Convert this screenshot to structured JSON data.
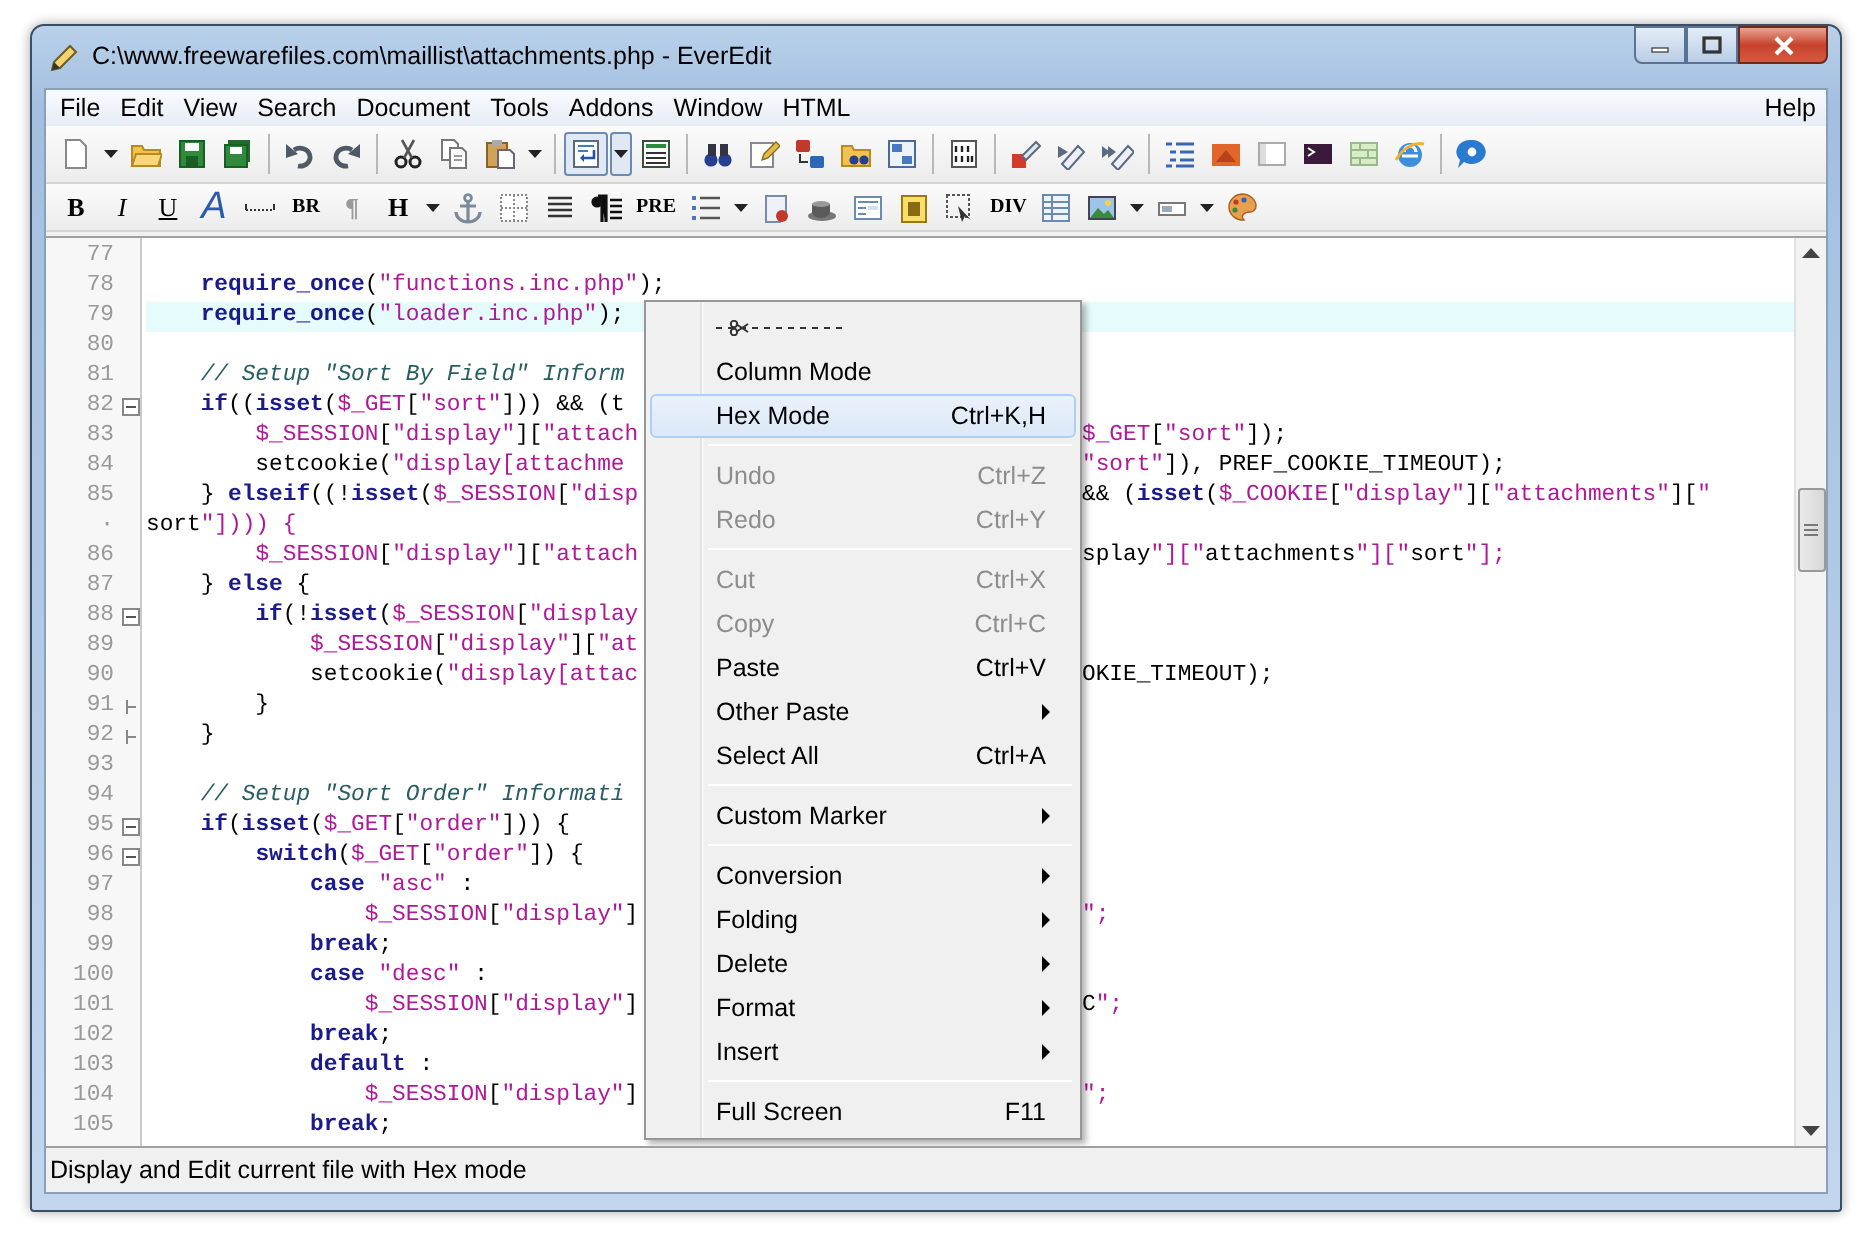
{
  "window": {
    "title": "C:\\www.freewarefiles.com\\maillist\\attachments.php - EverEdit"
  },
  "menus": [
    {
      "label": "File"
    },
    {
      "label": "Edit"
    },
    {
      "label": "View"
    },
    {
      "label": "Search"
    },
    {
      "label": "Document"
    },
    {
      "label": "Tools"
    },
    {
      "label": "Addons"
    },
    {
      "label": "Window"
    },
    {
      "label": "HTML"
    }
  ],
  "menus_right": [
    {
      "label": "Help"
    }
  ],
  "toolbars": [
    [
      {
        "kind": "icon",
        "pressed": false
      },
      {
        "kind": "drop",
        "pressed": false
      },
      {
        "kind": "icon",
        "pressed": false
      },
      {
        "kind": "icon",
        "pressed": false
      },
      {
        "kind": "icon",
        "pressed": false
      },
      {
        "kind": "sep"
      },
      {
        "kind": "icon",
        "pressed": false
      },
      {
        "kind": "icon",
        "pressed": false
      },
      {
        "kind": "sep"
      },
      {
        "kind": "icon",
        "pressed": false
      },
      {
        "kind": "icon",
        "pressed": false
      },
      {
        "kind": "icon",
        "pressed": false
      },
      {
        "kind": "drop",
        "pressed": false
      },
      {
        "kind": "sep"
      },
      {
        "kind": "icon",
        "pressed": true
      },
      {
        "kind": "drop",
        "pressed": true
      },
      {
        "kind": "icon",
        "pressed": false
      },
      {
        "kind": "sep"
      },
      {
        "kind": "icon",
        "pressed": false
      },
      {
        "kind": "icon",
        "pressed": false
      },
      {
        "kind": "icon",
        "pressed": false
      },
      {
        "kind": "icon",
        "pressed": false
      },
      {
        "kind": "icon",
        "pressed": false
      },
      {
        "kind": "sep"
      },
      {
        "kind": "icon",
        "pressed": false
      },
      {
        "kind": "sep"
      },
      {
        "kind": "icon",
        "pressed": false
      },
      {
        "kind": "icon",
        "pressed": false
      },
      {
        "kind": "icon",
        "pressed": false
      },
      {
        "kind": "sep"
      },
      {
        "kind": "icon",
        "pressed": false
      },
      {
        "kind": "icon",
        "pressed": false
      },
      {
        "kind": "icon",
        "pressed": false
      },
      {
        "kind": "icon",
        "pressed": false
      },
      {
        "kind": "icon",
        "pressed": false
      },
      {
        "kind": "icon",
        "pressed": false
      },
      {
        "kind": "sep"
      },
      {
        "kind": "icon",
        "pressed": false
      }
    ],
    [
      {
        "kind": "text",
        "label": "B",
        "disabled": false
      },
      {
        "kind": "text",
        "label": "I",
        "disabled": false
      },
      {
        "kind": "text",
        "label": "U",
        "disabled": false
      },
      {
        "kind": "text",
        "label": "A",
        "disabled": false
      },
      {
        "kind": "icon",
        "pressed": false
      },
      {
        "kind": "text",
        "label": "BR",
        "disabled": false
      },
      {
        "kind": "text",
        "label": "¶",
        "disabled": true
      },
      {
        "kind": "text",
        "label": "H",
        "disabled": false
      },
      {
        "kind": "drop",
        "pressed": false
      },
      {
        "kind": "icon",
        "pressed": false
      },
      {
        "kind": "icon",
        "pressed": false
      },
      {
        "kind": "icon",
        "pressed": false
      },
      {
        "kind": "icon",
        "pressed": false
      },
      {
        "kind": "text",
        "label": "PRE",
        "disabled": false
      },
      {
        "kind": "icon",
        "pressed": false
      },
      {
        "kind": "drop",
        "pressed": false
      },
      {
        "kind": "icon",
        "pressed": false
      },
      {
        "kind": "icon",
        "pressed": false
      },
      {
        "kind": "icon",
        "pressed": false
      },
      {
        "kind": "icon",
        "pressed": false
      },
      {
        "kind": "icon",
        "pressed": false
      },
      {
        "kind": "text",
        "label": "DIV",
        "disabled": false
      },
      {
        "kind": "icon",
        "pressed": false
      },
      {
        "kind": "icon",
        "pressed": false
      },
      {
        "kind": "drop",
        "pressed": false
      },
      {
        "kind": "icon",
        "pressed": false
      },
      {
        "kind": "drop",
        "pressed": false
      },
      {
        "kind": "icon",
        "pressed": false
      }
    ]
  ],
  "editor": {
    "lines": [
      {
        "kind": "plain",
        "num": "77",
        "current": false
      },
      {
        "kind": "plain",
        "num": "78",
        "text": "    require_once(\"functions.inc.php\");",
        "current": false
      },
      {
        "kind": "plain",
        "num": "79",
        "text": "    require_once(\"loader.inc.php\");",
        "current": true
      },
      {
        "kind": "plain",
        "num": "80",
        "current": false
      },
      {
        "kind": "plain",
        "num": "81",
        "text": "    // Setup \"Sort By Field\" Inform",
        "current": false
      },
      {
        "kind": "foldstart",
        "num": "82",
        "text": "    if((isset($_GET[\"sort\"])) && (t",
        "current": false
      },
      {
        "kind": "plain",
        "num": "83",
        "text": "        $_SESSION[\"display\"][\"attach",
        "tail": "$_GET[\"sort\"]);",
        "current": false
      },
      {
        "kind": "plain",
        "num": "84",
        "text": "        setcookie(\"display[attachme",
        "tail": "\"sort\"]), PREF_COOKIE_TIMEOUT);",
        "current": false
      },
      {
        "kind": "plain",
        "num": "85",
        "text": "    } elseif((!isset($_SESSION[\"disp",
        "tail": "&& (isset($_COOKIE[\"display\"][\"attachments\"][\"",
        "current": false
      },
      {
        "kind": "plain",
        "num": "·",
        "text": "sort\"]))) {",
        "current": false
      },
      {
        "kind": "plain",
        "num": "86",
        "text": "        $_SESSION[\"display\"][\"attach",
        "tail": "splay\"][\"attachments\"][\"sort\"];",
        "current": false
      },
      {
        "kind": "plain",
        "num": "87",
        "text": "    } else {",
        "current": false
      },
      {
        "kind": "foldstart",
        "num": "88",
        "text": "        if(!isset($_SESSION[\"display",
        "current": false
      },
      {
        "kind": "plain",
        "num": "89",
        "text": "            $_SESSION[\"display\"][\"at",
        "current": false
      },
      {
        "kind": "plain",
        "num": "90",
        "text": "            setcookie(\"display[attac",
        "tail": "OKIE_TIMEOUT);",
        "current": false
      },
      {
        "kind": "foldend",
        "num": "91",
        "text": "        }",
        "current": false
      },
      {
        "kind": "foldend",
        "num": "92",
        "text": "    }",
        "current": false
      },
      {
        "kind": "plain",
        "num": "93",
        "current": false
      },
      {
        "kind": "plain",
        "num": "94",
        "text": "    // Setup \"Sort Order\" Informati",
        "current": false
      },
      {
        "kind": "foldstart",
        "num": "95",
        "text": "    if(isset($_GET[\"order\"])) {",
        "current": false
      },
      {
        "kind": "foldstart",
        "num": "96",
        "text": "        switch($_GET[\"order\"]) {",
        "current": false
      },
      {
        "kind": "plain",
        "num": "97",
        "text": "            case \"asc\" :",
        "current": false
      },
      {
        "kind": "plain",
        "num": "98",
        "text": "                $_SESSION[\"display\"]",
        "tail": "\";",
        "current": false
      },
      {
        "kind": "plain",
        "num": "99",
        "text": "            break;",
        "current": false
      },
      {
        "kind": "plain",
        "num": "100",
        "text": "            case \"desc\" :",
        "current": false
      },
      {
        "kind": "plain",
        "num": "101",
        "text": "                $_SESSION[\"display\"]",
        "tail": "C\";",
        "current": false
      },
      {
        "kind": "plain",
        "num": "102",
        "text": "            break;",
        "current": false
      },
      {
        "kind": "plain",
        "num": "103",
        "text": "            default :",
        "current": false
      },
      {
        "kind": "plain",
        "num": "104",
        "text": "                $_SESSION[\"display\"]",
        "tail": "\";",
        "current": false
      },
      {
        "kind": "plain",
        "num": "105",
        "text": "            break;",
        "current": false
      }
    ]
  },
  "context_menu": {
    "items": [
      {
        "kind": "tearoff"
      },
      {
        "kind": "item",
        "label": "Column Mode",
        "selected": false,
        "disabled": false,
        "submenu": false
      },
      {
        "kind": "item",
        "label": "Hex Mode",
        "shortcut": "Ctrl+K,H",
        "selected": true,
        "disabled": false,
        "submenu": false
      },
      {
        "kind": "separator"
      },
      {
        "kind": "item",
        "label": "Undo",
        "shortcut": "Ctrl+Z",
        "selected": false,
        "disabled": true,
        "submenu": false
      },
      {
        "kind": "item",
        "label": "Redo",
        "shortcut": "Ctrl+Y",
        "selected": false,
        "disabled": true,
        "submenu": false
      },
      {
        "kind": "separator"
      },
      {
        "kind": "item",
        "label": "Cut",
        "shortcut": "Ctrl+X",
        "selected": false,
        "disabled": true,
        "submenu": false
      },
      {
        "kind": "item",
        "label": "Copy",
        "shortcut": "Ctrl+C",
        "selected": false,
        "disabled": true,
        "submenu": false
      },
      {
        "kind": "item",
        "label": "Paste",
        "shortcut": "Ctrl+V",
        "selected": false,
        "disabled": false,
        "submenu": false
      },
      {
        "kind": "item",
        "label": "Other Paste",
        "selected": false,
        "disabled": false,
        "submenu": true
      },
      {
        "kind": "item",
        "label": "Select All",
        "shortcut": "Ctrl+A",
        "selected": false,
        "disabled": false,
        "submenu": false
      },
      {
        "kind": "separator"
      },
      {
        "kind": "item",
        "label": "Custom Marker",
        "selected": false,
        "disabled": false,
        "submenu": true
      },
      {
        "kind": "separator"
      },
      {
        "kind": "item",
        "label": "Conversion",
        "selected": false,
        "disabled": false,
        "submenu": true
      },
      {
        "kind": "item",
        "label": "Folding",
        "selected": false,
        "disabled": false,
        "submenu": true
      },
      {
        "kind": "item",
        "label": "Delete",
        "selected": false,
        "disabled": false,
        "submenu": true
      },
      {
        "kind": "item",
        "label": "Format",
        "selected": false,
        "disabled": false,
        "submenu": true
      },
      {
        "kind": "item",
        "label": "Insert",
        "selected": false,
        "disabled": false,
        "submenu": true
      },
      {
        "kind": "separator"
      },
      {
        "kind": "item",
        "label": "Full Screen",
        "shortcut": "F11",
        "selected": false,
        "disabled": false,
        "submenu": false
      }
    ]
  },
  "status_bar": {
    "text": "Display and Edit current file with Hex mode"
  }
}
